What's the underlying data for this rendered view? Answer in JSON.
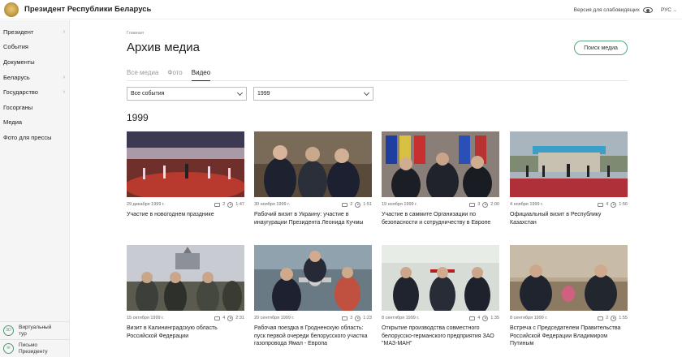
{
  "header": {
    "site_title": "Президент Республики Беларусь",
    "accessibility_label": "Версия для слабовидящих",
    "language": "РУС"
  },
  "sidebar": {
    "items": [
      {
        "label": "Президент",
        "has_submenu": true
      },
      {
        "label": "События",
        "has_submenu": false
      },
      {
        "label": "Документы",
        "has_submenu": false
      },
      {
        "label": "Беларусь",
        "has_submenu": true
      },
      {
        "label": "Государство",
        "has_submenu": true
      },
      {
        "label": "Госорганы",
        "has_submenu": false
      },
      {
        "label": "Медиа",
        "has_submenu": false
      },
      {
        "label": "Фото для прессы",
        "has_submenu": false
      }
    ],
    "bottom_links": [
      {
        "label": "Виртуальный тур",
        "icon": "3D"
      },
      {
        "label": "Письмо Президенту",
        "icon": "✉"
      }
    ]
  },
  "main": {
    "breadcrumb": "Главная",
    "title": "Архив медиа",
    "search_button": "Поиск медиа",
    "tabs": [
      {
        "label": "Все медиа",
        "active": false
      },
      {
        "label": "Фото",
        "active": false
      },
      {
        "label": "Видео",
        "active": true
      }
    ],
    "filters": {
      "events": "Все события",
      "year": "1999"
    },
    "year_heading": "1999"
  },
  "cards": [
    {
      "date": "29 декабря 1999 г.",
      "photos": "2",
      "duration": "1:47",
      "title": "Участие в новогоднем празднике"
    },
    {
      "date": "30 ноября 1999 г.",
      "photos": "2",
      "duration": "1:51",
      "title": "Рабочий визит в Украину: участие в инаугурации Президента Леонида Кучмы"
    },
    {
      "date": "19 ноября 1999 г.",
      "photos": "3",
      "duration": "2:00",
      "title": "Участие в саммите Организации по безопасности и сотрудничеству в Европе"
    },
    {
      "date": "4 ноября 1999 г.",
      "photos": "4",
      "duration": "1:56",
      "title": "Официальный визит в Республику Казахстан"
    },
    {
      "date": "15 октября 1999 г.",
      "photos": "4",
      "duration": "2:31",
      "title": "Визит в Калининградскую область Российской Федерации"
    },
    {
      "date": "20 сентября 1999 г.",
      "photos": "3",
      "duration": "1:23",
      "title": "Рабочая поездка в Гродненскую область: пуск первой очереди белорусского участка газопровода Ямал - Европа"
    },
    {
      "date": "8 сентября 1999 г.",
      "photos": "4",
      "duration": "1:35",
      "title": "Открытие производства совместного белорусско-германского предприятия ЗАО \"МАЗ-МАН\""
    },
    {
      "date": "8 сентября 1999 г.",
      "photos": "2",
      "duration": "1:55",
      "title": "Встреча с Председателем Правительства Российской Федерации Владимиром Путиным"
    }
  ],
  "colors": {
    "accent_green": "#5aa47a",
    "sidebar_bg": "#f5f5f5"
  }
}
